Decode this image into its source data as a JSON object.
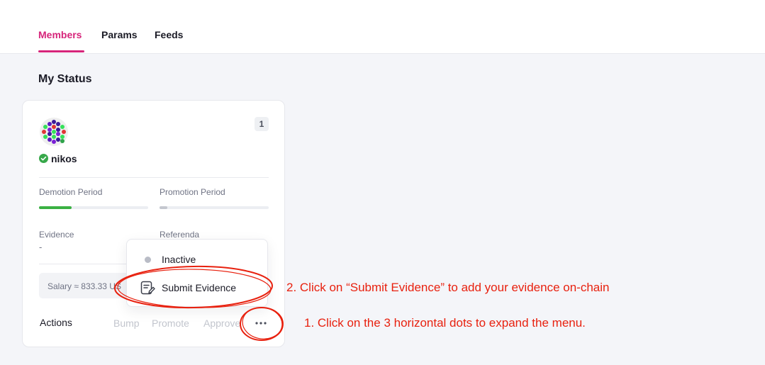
{
  "tabs": [
    {
      "label": "Members",
      "active": true
    },
    {
      "label": "Params",
      "active": false
    },
    {
      "label": "Feeds",
      "active": false
    }
  ],
  "section_title": "My Status",
  "member_card": {
    "rank": "1",
    "username": "nikos",
    "demotion_label": "Demotion Period",
    "demotion_progress_pct": 30,
    "promotion_label": "Promotion Period",
    "promotion_progress_pct": 7,
    "evidence_label": "Evidence",
    "evidence_value": "-",
    "referenda_label": "Referenda",
    "salary_text": "Salary ≈ 833.33 US",
    "actions_label": "Actions",
    "actions": [
      "Bump",
      "Promote",
      "Approve"
    ]
  },
  "dropdown": {
    "items": [
      {
        "label": "Inactive",
        "icon": "status-dot-icon"
      },
      {
        "label": "Submit Evidence",
        "icon": "document-edit-icon"
      }
    ]
  },
  "annotations": {
    "step2": "2. Click on “Submit Evidence” to add your evidence on-chain",
    "step1": "1. Click on the 3 horizontal dots to expand the menu."
  },
  "colors": {
    "accent": "#d6247a",
    "progress_green": "#3bb143",
    "annotation_red": "#e8210f",
    "verified_green": "#37a84a"
  }
}
